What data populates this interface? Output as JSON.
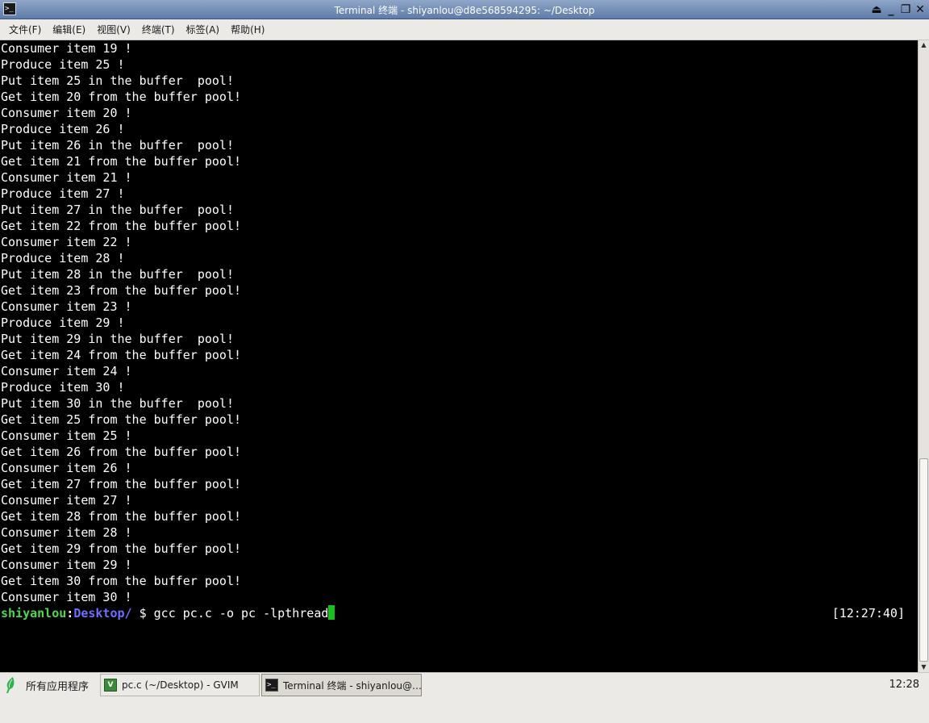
{
  "window": {
    "title": "Terminal 终端 - shiyanlou@d8e568594295: ~/Desktop",
    "controls": [
      "⏏",
      "_",
      "❐",
      "✕"
    ]
  },
  "menu": [
    "文件(F)",
    "编辑(E)",
    "视图(V)",
    "终端(T)",
    "标签(A)",
    "帮助(H)"
  ],
  "terminal": {
    "lines": [
      "Consumer item 19 !",
      "Produce item 25 !",
      "Put item 25 in the buffer  pool!",
      "Get item 20 from the buffer pool!",
      "Consumer item 20 !",
      "Produce item 26 !",
      "Put item 26 in the buffer  pool!",
      "Get item 21 from the buffer pool!",
      "Consumer item 21 !",
      "Produce item 27 !",
      "Put item 27 in the buffer  pool!",
      "Get item 22 from the buffer pool!",
      "Consumer item 22 !",
      "Produce item 28 !",
      "Put item 28 in the buffer  pool!",
      "Get item 23 from the buffer pool!",
      "Consumer item 23 !",
      "Produce item 29 !",
      "Put item 29 in the buffer  pool!",
      "Get item 24 from the buffer pool!",
      "Consumer item 24 !",
      "Produce item 30 !",
      "Put item 30 in the buffer  pool!",
      "Get item 25 from the buffer pool!",
      "Consumer item 25 !",
      "Get item 26 from the buffer pool!",
      "Consumer item 26 !",
      "Get item 27 from the buffer pool!",
      "Consumer item 27 !",
      "Get item 28 from the buffer pool!",
      "Consumer item 28 !",
      "Get item 29 from the buffer pool!",
      "Consumer item 29 !",
      "Get item 30 from the buffer pool!",
      "Consumer item 30 !"
    ],
    "prompt": {
      "user": "shiyanlou",
      "separator": ":",
      "dir": "Desktop/",
      "symbol": " $ ",
      "command": "gcc pc.c -o pc -lpthread",
      "timestamp": "[12:27:40]"
    },
    "colors": {
      "background": "#000000",
      "text": "#ffffff",
      "user": "#4fd64f",
      "dir": "#6f6fff",
      "cursor": "#16c21c"
    }
  },
  "taskbar": {
    "apps_label": "所有应用程序",
    "tasks": [
      {
        "label": "pc.c (~/Desktop) - GVIM",
        "icon": "gvim-icon"
      },
      {
        "label": "Terminal 终端 - shiyanlou@…",
        "icon": "terminal-icon"
      }
    ],
    "clock": "12:28"
  }
}
